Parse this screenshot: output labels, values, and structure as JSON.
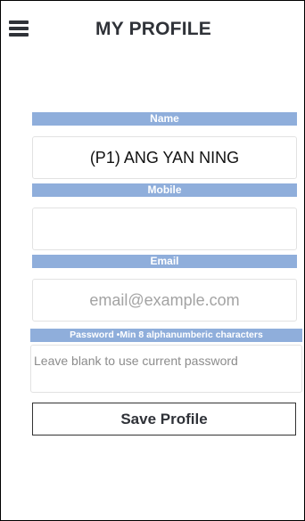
{
  "header": {
    "title": "MY PROFILE",
    "menu_icon": "hamburger-menu-icon"
  },
  "form": {
    "name": {
      "label": "Name",
      "value": "(P1) ANG YAN NING",
      "placeholder": ""
    },
    "mobile": {
      "label": "Mobile",
      "value": "",
      "placeholder": ""
    },
    "email": {
      "label": "Email",
      "value": "",
      "placeholder": "email@example.com"
    },
    "password": {
      "label": "Password •Min 8 alphanumberic characters",
      "value": "",
      "placeholder": "Leave blank to use current password"
    },
    "save_label": "Save Profile"
  },
  "colors": {
    "label_bg": "#8faedb",
    "text_dark": "#2f3238"
  }
}
